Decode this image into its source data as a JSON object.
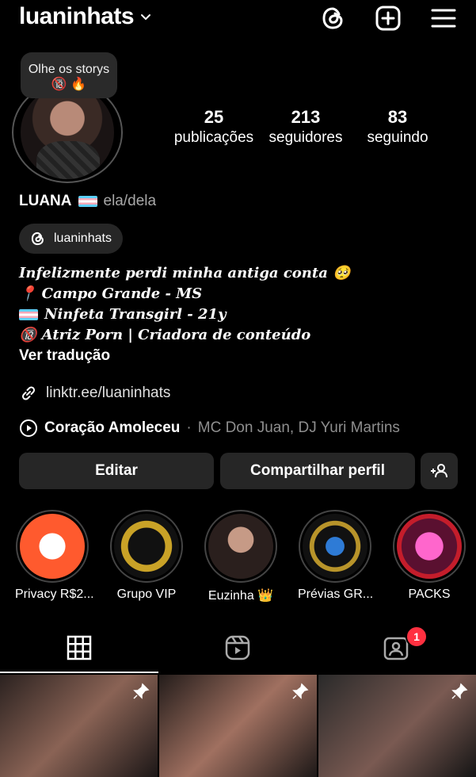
{
  "header": {
    "username": "luaninhats",
    "icons": [
      "chevron-down-icon",
      "threads-icon",
      "create-icon",
      "menu-icon"
    ]
  },
  "story_note": "Olhe os storys 🔞 🔥",
  "stats": [
    {
      "value": "25",
      "label": "publicações"
    },
    {
      "value": "213",
      "label": "seguidores"
    },
    {
      "value": "83",
      "label": "seguindo"
    }
  ],
  "profile": {
    "name": "LUANA",
    "pronouns": "ela/dela",
    "threads_handle": "luaninhats",
    "bio_lines": [
      "Infelizmente perdi minha antiga conta 🥺",
      "📍 Campo Grande - MS",
      "Ninfeta Transgirl - 21y",
      "🔞 Atriz Porn | Criadora de conteúdo"
    ],
    "translate": "Ver tradução",
    "link": "linktr.ee/luaninhats",
    "music_title": "Coração Amoleceu",
    "music_separator": "·",
    "music_artist": "MC Don Juan, DJ Yuri Martins"
  },
  "actions": {
    "edit": "Editar",
    "share": "Compartilhar perfil"
  },
  "highlights": [
    {
      "label": "Privacy R$2..."
    },
    {
      "label": "Grupo VIP"
    },
    {
      "label": "Euzinha 👑"
    },
    {
      "label": "Prévias GR..."
    },
    {
      "label": "PACKS"
    }
  ],
  "tabs": {
    "tagged_badge": "1"
  },
  "colors": {
    "background": "#000000",
    "button": "#262626",
    "badge": "#ff3040",
    "muted": "#8e8e8e"
  }
}
